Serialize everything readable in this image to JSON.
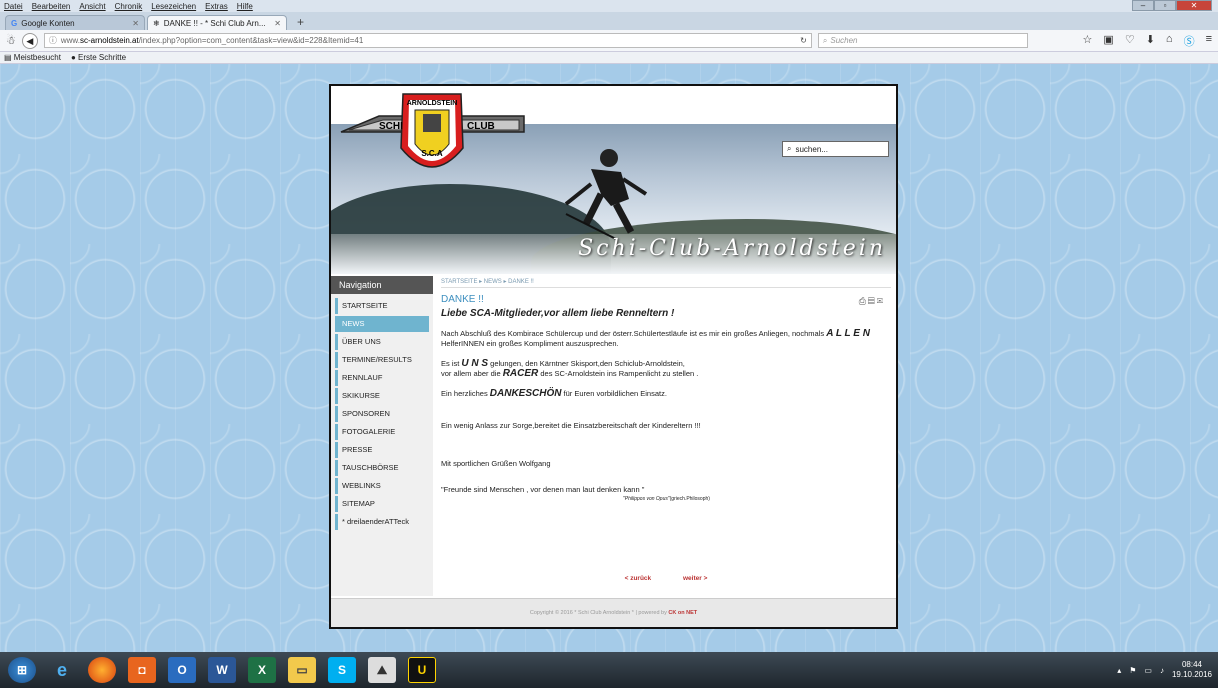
{
  "menubar": [
    "Datei",
    "Bearbeiten",
    "Ansicht",
    "Chronik",
    "Lesezeichen",
    "Extras",
    "Hilfe"
  ],
  "tabs": [
    {
      "label": "Google Konten",
      "icon": "google-icon"
    },
    {
      "label": "DANKE !! - * Schi Club Arn...",
      "icon": "site-icon"
    }
  ],
  "url": {
    "prefix": "www.",
    "host": "sc-arnoldstein.at",
    "path": "/index.php?option=com_content&task=view&id=228&Itemid=41"
  },
  "search_placeholder": "Suchen",
  "bookmarks": [
    "Meistbesucht",
    "Erste Schritte"
  ],
  "site": {
    "logo_top": "ARNOLDSTEIN",
    "logo_left": "SCHI",
    "logo_right": "CLUB",
    "logo_badge": "S.C.A",
    "search_placeholder": "suchen...",
    "script_title": "Schi-Club-Arnoldstein",
    "nav_header": "Navigation",
    "nav_items": [
      "STARTSEITE",
      "NEWS",
      "ÜBER UNS",
      "TERMINE/RESULTS",
      "RENNLAUF",
      "SKIKURSE",
      "SPONSOREN",
      "FOTOGALERIE",
      "PRESSE",
      "TAUSCHBÖRSE",
      "WEBLINKS",
      "SITEMAP",
      "* dreilaenderATTeck"
    ],
    "active_nav": "NEWS",
    "breadcrumb": "STARTSEITE ▸ NEWS ▸ DANKE !!",
    "title": "DANKE !!",
    "subtitle": "Liebe SCA-Mitglieder,vor allem liebe Renneltern !",
    "p1_a": "Nach Abschluß des Kombirace Schülercup und der österr.Schülertestläufe ist es mir ein großes Anliegen, nochmals ",
    "p1_b": "A L L E N",
    "p1_c": " HelferINNEN ein großes Kompliment auszusprechen.",
    "p2_a": "Es ist ",
    "p2_b": "U N S",
    "p2_c": " gelungen, den Kärntner Skisport,den Schiclub-Arnoldstein,",
    "p2_d": "vor allem aber die ",
    "p2_e": "RACER",
    "p2_f": " des SC-Arnoldstein ins Rampenlicht zu stellen .",
    "p3_a": "Ein herzliches ",
    "p3_b": "DANKESCHÖN",
    "p3_c": " für Euren vorbildlichen Einsatz.",
    "p4": "Ein wenig Anlass zur Sorge,bereitet die Einsatzbereitschaft der Kindereltern !!!",
    "p5": "Mit sportlichen Grüßen  Wolfgang",
    "p6": "\"Freunde sind Menschen , vor denen man laut denken kann \"",
    "p6_src_a": "\"Philippos von Opus\"",
    "p6_src_b": "(griech.Philosoph)",
    "prev": "< zurück",
    "next": "weiter >",
    "footer_a": "Copyright © 2016 * Schi Club Arnoldstein * | powered by ",
    "footer_b": "CK on NET"
  },
  "taskbar": {
    "time": "08:44",
    "date": "19.10.2016"
  }
}
